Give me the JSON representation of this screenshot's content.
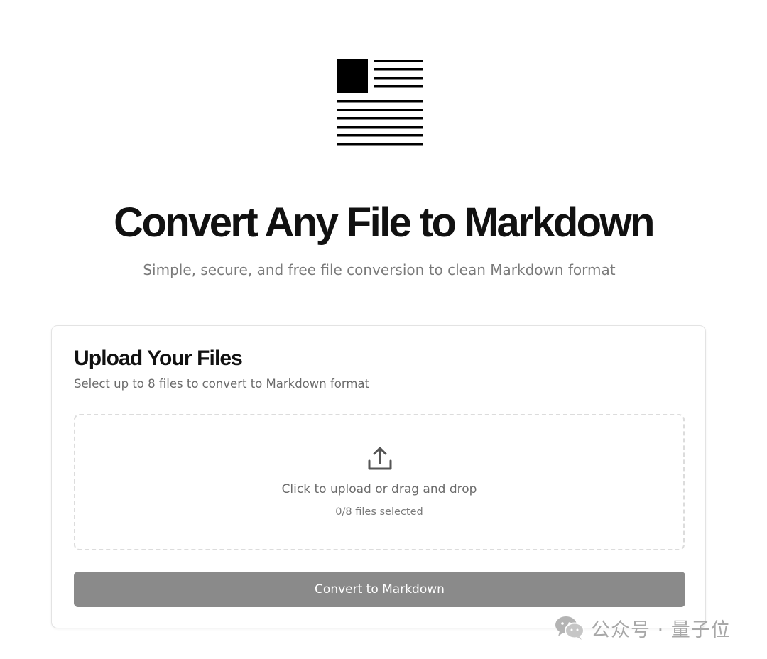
{
  "hero": {
    "title": "Convert Any File to Markdown",
    "subtitle": "Simple, secure, and free file conversion to clean Markdown format"
  },
  "upload_card": {
    "title": "Upload Your Files",
    "description": "Select up to 8 files to convert to Markdown format",
    "dropzone": {
      "icon": "upload-icon",
      "prompt": "Click to upload or drag and drop",
      "selected_count": "0/8 files selected"
    },
    "convert_button_label": "Convert to Markdown"
  },
  "watermark": {
    "icon": "wechat-icon",
    "text": "公众号 · 量子位"
  },
  "colors": {
    "button_disabled": "#8a8a8a",
    "text_primary": "#111111",
    "text_muted": "#6b6b6b",
    "border": "#e3e3e3"
  }
}
